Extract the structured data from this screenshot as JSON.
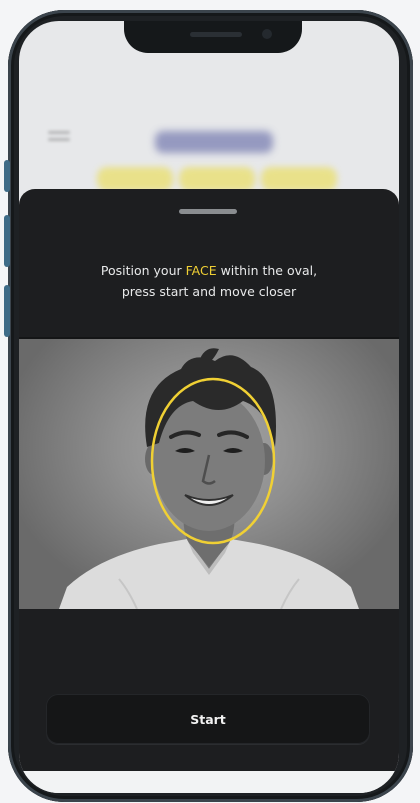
{
  "instruction": {
    "before": "Position your ",
    "highlight": "FACE",
    "after_line1": " within the oval,",
    "line2": "press start and move closer"
  },
  "start_button": {
    "label": "Start"
  },
  "colors": {
    "accent": "#f0d034",
    "sheet_background": "#1d1e20",
    "frame": "#1e2124"
  },
  "icons": [
    "menu-icon",
    "face-oval-guide"
  ]
}
